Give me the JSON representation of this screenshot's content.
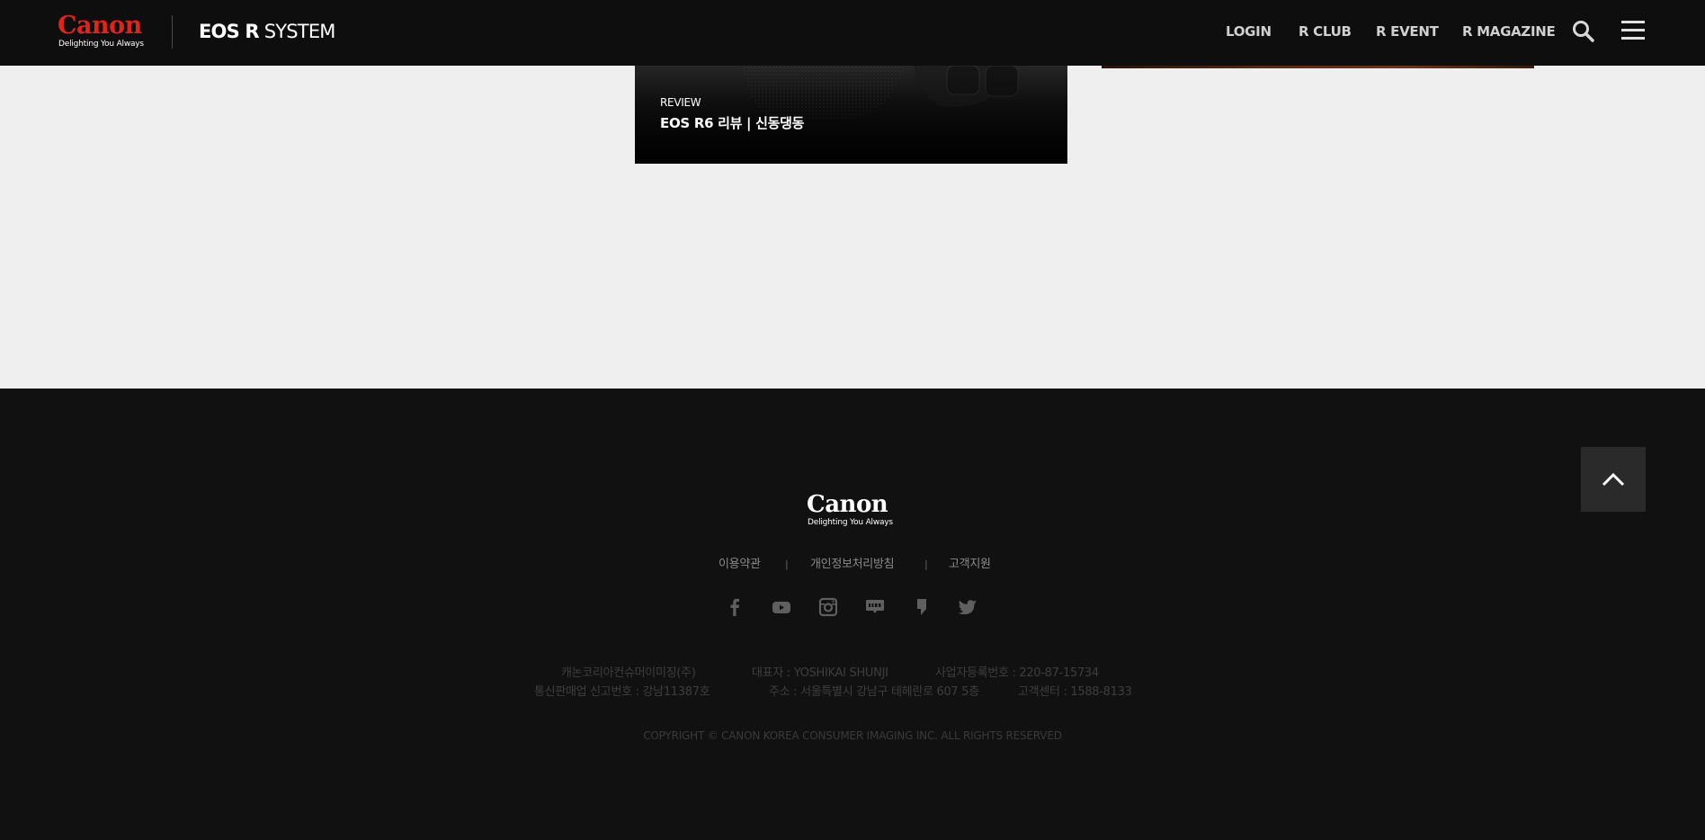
{
  "header": {
    "logo_text": "Canon",
    "logo_tagline": "Delighting You Always",
    "system_title_bold": "EOS R",
    "system_title_light": "SYSTEM",
    "nav": [
      {
        "label": "LOGIN"
      },
      {
        "label": "R CLUB"
      },
      {
        "label": "R EVENT"
      },
      {
        "label": "R MAGAZINE"
      }
    ],
    "search_icon": "search-icon",
    "menu_icon": "hamburger-menu-icon"
  },
  "content": {
    "review_card": {
      "category": "REVIEW",
      "title": "EOS R6 리뷰 | 신동댕동"
    }
  },
  "footer": {
    "logo_text": "Canon",
    "logo_tagline": "Delighting You Always",
    "links": [
      {
        "label": "이용약관"
      },
      {
        "label": "개인정보처리방침"
      },
      {
        "label": "고객지원"
      }
    ],
    "link_separator": "|",
    "social": [
      {
        "icon": "facebook-icon"
      },
      {
        "icon": "youtube-icon"
      },
      {
        "icon": "instagram-icon"
      },
      {
        "icon": "blog-icon"
      },
      {
        "icon": "post-icon"
      },
      {
        "icon": "twitter-icon"
      }
    ],
    "company_info": {
      "company": "캐논코리아컨슈머이미징(주)",
      "ceo": "대표자 : YOSHIKAI SHUNJI",
      "business_number": "사업자등록번호 : 220-87-15734",
      "mail_order": "통신판매업 신고번호 : 강남11387호",
      "address": "주소 : 서울특별시 강남구 테헤란로 607 5층",
      "customer_center": "고객센터 : 1588-8133"
    },
    "copyright": "COPYRIGHT © CANON KOREA CONSUMER IMAGING INC. ALL RIGHTS RESERVED",
    "back_to_top_icon": "chevron-up-icon"
  },
  "colors": {
    "canon_red": "#e2231a",
    "header_bg": "#0e0e0e",
    "page_bg": "#efefef",
    "footer_bg": "#111112"
  }
}
